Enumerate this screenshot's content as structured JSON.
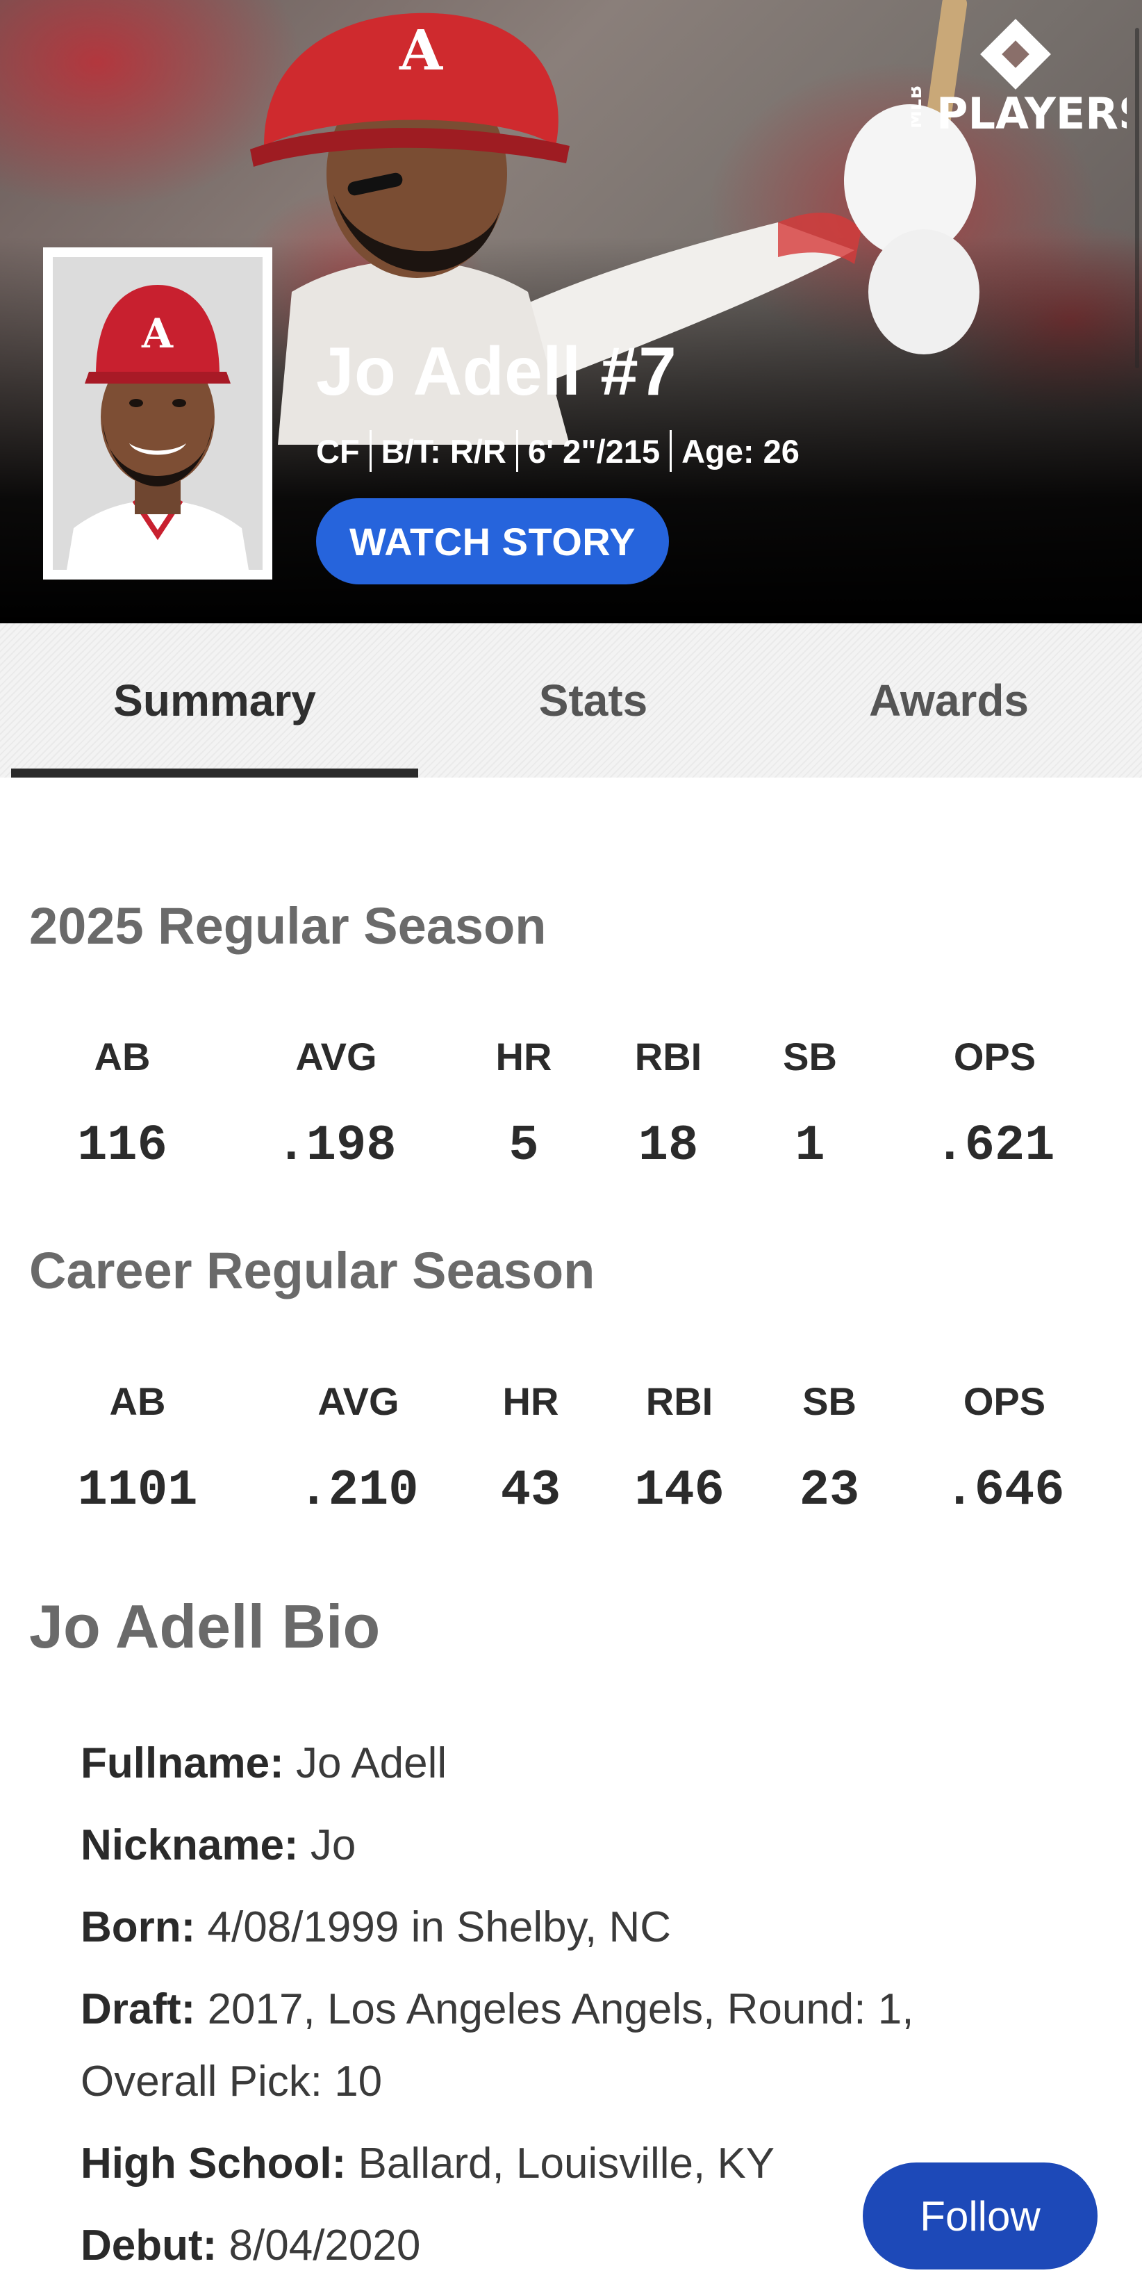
{
  "hero": {
    "name": "Jo Adell #7",
    "position": "CF",
    "bats_throws": "B/T: R/R",
    "height_weight": "6' 2\"/215",
    "age": "Age: 26",
    "watch_story_label": "WATCH STORY",
    "logo_small_text": "MLB",
    "logo_text": "PLAYERS"
  },
  "tabs": {
    "summary": "Summary",
    "stats": "Stats",
    "awards": "Awards",
    "active": "Summary"
  },
  "season": {
    "title": "2025 Regular Season",
    "headers": [
      "AB",
      "AVG",
      "HR",
      "RBI",
      "SB",
      "OPS"
    ],
    "values": [
      "116",
      ".198",
      "5",
      "18",
      "1",
      ".621"
    ]
  },
  "career": {
    "title": "Career Regular Season",
    "headers": [
      "AB",
      "AVG",
      "HR",
      "RBI",
      "SB",
      "OPS"
    ],
    "values": [
      "1101",
      ".210",
      "43",
      "146",
      "23",
      ".646"
    ]
  },
  "bio": {
    "title": "Jo Adell Bio",
    "fullname_label": "Fullname:",
    "fullname": "Jo Adell",
    "nickname_label": "Nickname:",
    "nickname": "Jo",
    "born_label": "Born:",
    "born": "4/08/1999 in Shelby, NC",
    "draft_label": "Draft:",
    "draft": "2017, Los Angeles Angels, Round: 1, Overall Pick: 10",
    "high_school_label": "High School:",
    "high_school": "Ballard, Louisville, KY",
    "debut_label": "Debut:",
    "debut": "8/04/2020"
  },
  "follow_label": "Follow",
  "colors": {
    "watch_story_button": "#2664dc",
    "follow_button": "#1d49b8",
    "angels_red": "#c8202f"
  }
}
